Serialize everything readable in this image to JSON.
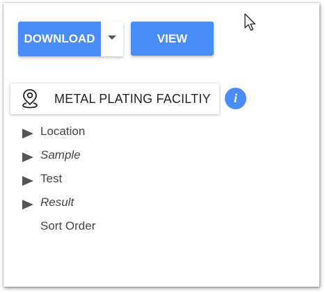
{
  "toolbar": {
    "download_label": "DOWNLOAD",
    "view_label": "VIEW"
  },
  "facility": {
    "name": "METAL PLATING FACILTIY",
    "icon": "map-pin-icon",
    "info_icon_text": "i"
  },
  "tree": {
    "items": [
      {
        "label": "Location",
        "italic": false,
        "expandable": true
      },
      {
        "label": "Sample",
        "italic": true,
        "expandable": true
      },
      {
        "label": "Test",
        "italic": false,
        "expandable": true
      },
      {
        "label": "Result",
        "italic": true,
        "expandable": true
      },
      {
        "label": "Sort Order",
        "italic": false,
        "expandable": false
      }
    ]
  },
  "colors": {
    "accent": "#4a8df8",
    "text": "#444444"
  }
}
